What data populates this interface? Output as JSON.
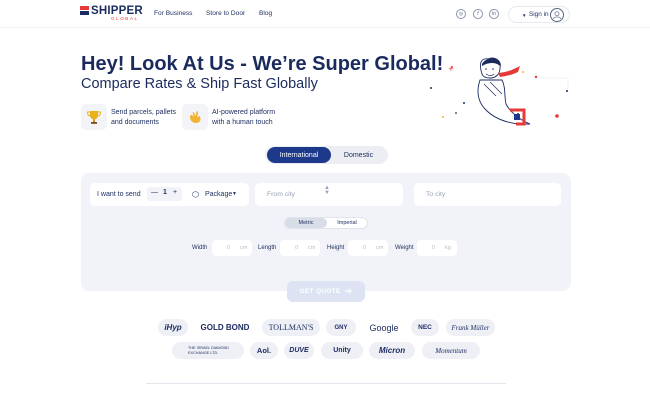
{
  "header": {
    "brand": "SHIPPER",
    "brand_sub": "GLOBAL",
    "nav": [
      "For Business",
      "Store to Door",
      "Blog"
    ],
    "social_icons": [
      "instagram-icon",
      "facebook-icon",
      "linkedin-icon"
    ],
    "signin_label": "Sign in"
  },
  "hero": {
    "title": "Hey! Look At Us - We’re Super Global!",
    "subtitle": "Compare Rates & Ship Fast Globally",
    "features": [
      {
        "icon": "trophy-icon",
        "line1": "Send parcels, pallets",
        "line2": "and documents"
      },
      {
        "icon": "thumbs-up-icon",
        "line1": "AI-powered platform",
        "line2": "with a human touch"
      }
    ]
  },
  "tabs": {
    "international": "International",
    "domestic": "Domestic",
    "active": "International"
  },
  "form": {
    "send_label": "I want to send",
    "quantity": "1",
    "minus": "—",
    "plus": "+",
    "package_label": "Package",
    "from_placeholder": "From city",
    "to_placeholder": "To city",
    "units": {
      "metric": "Metric",
      "imperial": "Imperial",
      "active": "Metric"
    },
    "dimensions": [
      {
        "label": "Width",
        "value": "0",
        "unit": "cm"
      },
      {
        "label": "Length",
        "value": "0",
        "unit": "cm"
      },
      {
        "label": "Height",
        "value": "0",
        "unit": "cm"
      },
      {
        "label": "Weight",
        "value": "0",
        "unit": "kg"
      }
    ],
    "quote_button": "GET QUOTE"
  },
  "logos_row1": [
    "iHyp",
    "GOLD BOND",
    "TOLLMAN'S",
    "GNY",
    "Google",
    "NEC",
    "Frank Müller"
  ],
  "logos_row2": [
    "THE ISRAEL DIAMOND EXCHANGE LTD.",
    "Aol.",
    "DUVE",
    "Unity",
    "Micron",
    "Momentum"
  ],
  "colors": {
    "navy": "#1b2b5e",
    "accent_red": "#e63a3a",
    "tab_active": "#1d3a8a",
    "panel_bg": "#f1f3f8"
  }
}
